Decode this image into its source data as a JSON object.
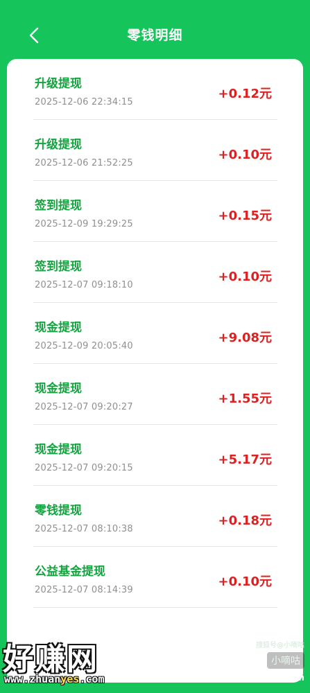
{
  "header": {
    "title": "零钱明细",
    "back_icon": "chevron-left-icon"
  },
  "records": [
    {
      "title": "升级提现",
      "time": "2025-12-06 22:34:15",
      "amount": "+0.12元"
    },
    {
      "title": "升级提现",
      "time": "2025-12-06 21:52:25",
      "amount": "+0.10元"
    },
    {
      "title": "签到提现",
      "time": "2025-12-09 19:29:25",
      "amount": "+0.15元"
    },
    {
      "title": "签到提现",
      "time": "2025-12-07 09:18:10",
      "amount": "+0.10元"
    },
    {
      "title": "现金提现",
      "time": "2025-12-09 20:05:40",
      "amount": "+9.08元"
    },
    {
      "title": "现金提现",
      "time": "2025-12-07 09:20:27",
      "amount": "+1.55元"
    },
    {
      "title": "现金提现",
      "time": "2025-12-07 09:20:15",
      "amount": "+5.17元"
    },
    {
      "title": "零钱提现",
      "time": "2025-12-07 08:10:38",
      "amount": "+0.18元"
    },
    {
      "title": "公益基金提现",
      "time": "2025-12-07 08:14:39",
      "amount": "+0.10元"
    }
  ],
  "watermark": {
    "left_big": "好赚网",
    "left_url_pre": "www.zhuan",
    "left_url_hl": "yes",
    "left_url_post": ".com",
    "right_small": "搜狐号@小嘀咕",
    "right_mid": "小嘀咕",
    "right_domain": "xdglt.com"
  },
  "colors": {
    "background": "#15c45a",
    "title_green": "#13a33f",
    "amount_red": "#e02020"
  }
}
